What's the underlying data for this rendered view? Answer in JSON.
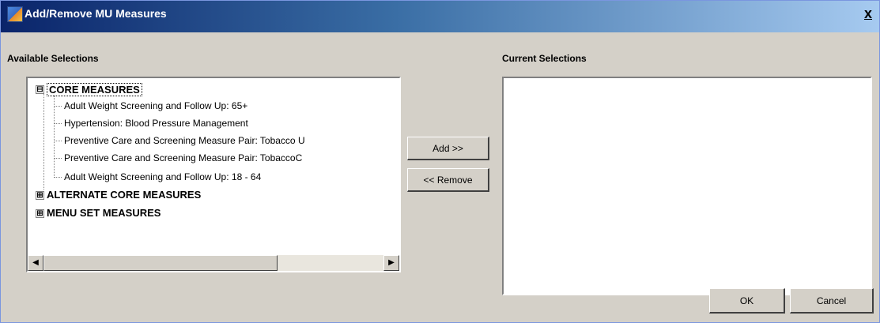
{
  "window": {
    "title": "Add/Remove MU Measures",
    "close_glyph": "x"
  },
  "available": {
    "label": "Available Selections",
    "tree": [
      {
        "label": "CORE MEASURES",
        "expanded": true,
        "toggle": "⊟",
        "children": [
          "Adult Weight Screening and Follow Up: 65+",
          "Hypertension: Blood Pressure Management",
          "Preventive Care and Screening Measure Pair: Tobacco U",
          "Preventive Care and Screening Measure Pair: TobaccoC",
          "Adult Weight Screening and Follow Up: 18 - 64"
        ]
      },
      {
        "label": "ALTERNATE CORE MEASURES",
        "expanded": false,
        "toggle": "⊞"
      },
      {
        "label": "MENU SET MEASURES",
        "expanded": false,
        "toggle": "⊞"
      }
    ],
    "scroll_left": "◀",
    "scroll_right": "▶"
  },
  "current": {
    "label": "Current Selections",
    "items": []
  },
  "buttons": {
    "add": "Add >>",
    "remove": "<< Remove",
    "ok": "OK",
    "cancel": "Cancel"
  }
}
